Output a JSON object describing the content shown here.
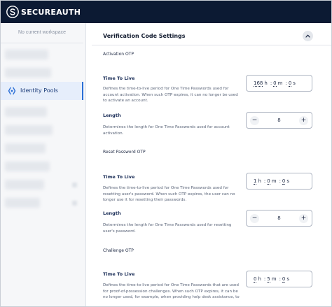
{
  "app": {
    "brand": "SECUREAUTH"
  },
  "sidebar": {
    "workspace": "No current workspace",
    "active_item": {
      "label": "Identity Pools"
    }
  },
  "section": {
    "title": "Verification Code Settings",
    "groups": [
      {
        "heading": "Activation OTP",
        "ttl": {
          "label": "Time To Live",
          "description": "Defines the time-to-live period for One Time Passwords used for account activation. When such OTP expires, it can no longer be used to activate an account.",
          "hours": "168",
          "minutes": "0",
          "seconds": "0"
        },
        "length": {
          "label": "Length",
          "description": "Determines the length for One Time Passwords used for account activation.",
          "value": "8"
        }
      },
      {
        "heading": "Reset Password OTP",
        "ttl": {
          "label": "Time To Live",
          "description": "Defines the time-to-live period for One Time Passwords used for resetting user's password. When such OTP expires, the user can no longer use it for resetting their passwords.",
          "hours": "1",
          "minutes": "0",
          "seconds": "0"
        },
        "length": {
          "label": "Length",
          "description": "Determines the length for One Time Passwords used for resetting user's password.",
          "value": "8"
        }
      },
      {
        "heading": "Challenge OTP",
        "ttl": {
          "label": "Time To Live",
          "description": "Defines the time-to-live period for One Time Passwords that are used for proof-of-possession challenges. When such OTP expires, it can be no longer used, for example, when providing help desk assistance, to",
          "hours": "0",
          "minutes": "5",
          "seconds": "0"
        }
      }
    ]
  },
  "units": {
    "h": "h",
    "m": "m",
    "s": "s",
    "sep": ":"
  },
  "stepper": {
    "minus": "−",
    "plus": "+"
  },
  "icons": {
    "logo": "secureauth-logo-icon",
    "identity_pools": "identity-pools-icon",
    "collapse": "chevron-up-icon"
  },
  "colors": {
    "topbar": "#0c1a33",
    "accent": "#2b6fd6",
    "active_bg": "#e6eefb"
  }
}
